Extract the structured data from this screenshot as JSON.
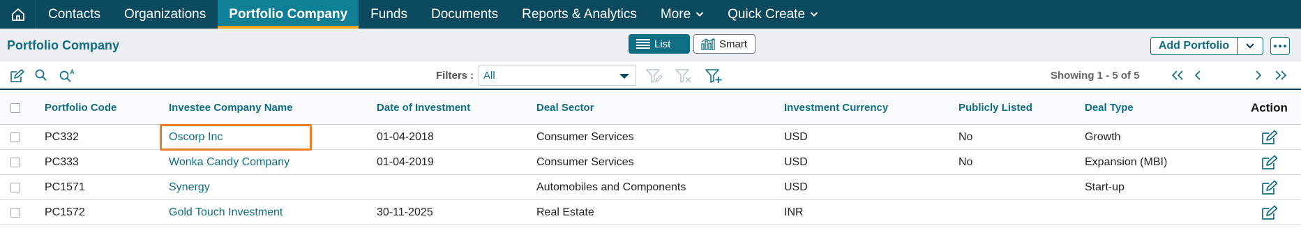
{
  "nav": {
    "items": [
      {
        "label": "Contacts",
        "has_caret": false,
        "active": false
      },
      {
        "label": "Organizations",
        "has_caret": false,
        "active": false
      },
      {
        "label": "Portfolio Company",
        "has_caret": false,
        "active": true
      },
      {
        "label": "Funds",
        "has_caret": false,
        "active": false
      },
      {
        "label": "Documents",
        "has_caret": false,
        "active": false
      },
      {
        "label": "Reports & Analytics",
        "has_caret": false,
        "active": false
      },
      {
        "label": "More",
        "has_caret": true,
        "active": false
      },
      {
        "label": "Quick Create",
        "has_caret": true,
        "active": false
      }
    ]
  },
  "titlebar": {
    "title": "Portfolio Company",
    "list_label": "List",
    "smart_label": "Smart",
    "add_label": "Add Portfolio"
  },
  "toolbar": {
    "filters_label": "Filters :",
    "filter_value": "All",
    "showing": "Showing 1 - 5 of 5"
  },
  "table": {
    "headers": [
      "Portfolio Code",
      "Investee Company Name",
      "Date of Investment",
      "Deal Sector",
      "Investment Currency",
      "Publicly Listed",
      "Deal Type",
      "Action"
    ],
    "rows": [
      {
        "code": "PC332",
        "company": "Oscorp Inc",
        "date": "01-04-2018",
        "sector": "Consumer Services",
        "currency": "USD",
        "listed": "No",
        "deal_type": "Growth"
      },
      {
        "code": "PC333",
        "company": "Wonka Candy Company",
        "date": "01-04-2019",
        "sector": "Consumer Services",
        "currency": "USD",
        "listed": "No",
        "deal_type": "Expansion (MBI)"
      },
      {
        "code": "PC1571",
        "company": "Synergy",
        "date": "",
        "sector": "Automobiles and Components",
        "currency": "USD",
        "listed": "",
        "deal_type": "Start-up"
      },
      {
        "code": "PC1572",
        "company": "Gold Touch Investment",
        "date": "30-11-2025",
        "sector": "Real Estate",
        "currency": "INR",
        "listed": "",
        "deal_type": ""
      }
    ]
  },
  "colors": {
    "nav_bg": "#0b4a5e",
    "accent": "#0f6e84",
    "active_underline": "#f2a31c",
    "highlight": "#ef7b22"
  }
}
